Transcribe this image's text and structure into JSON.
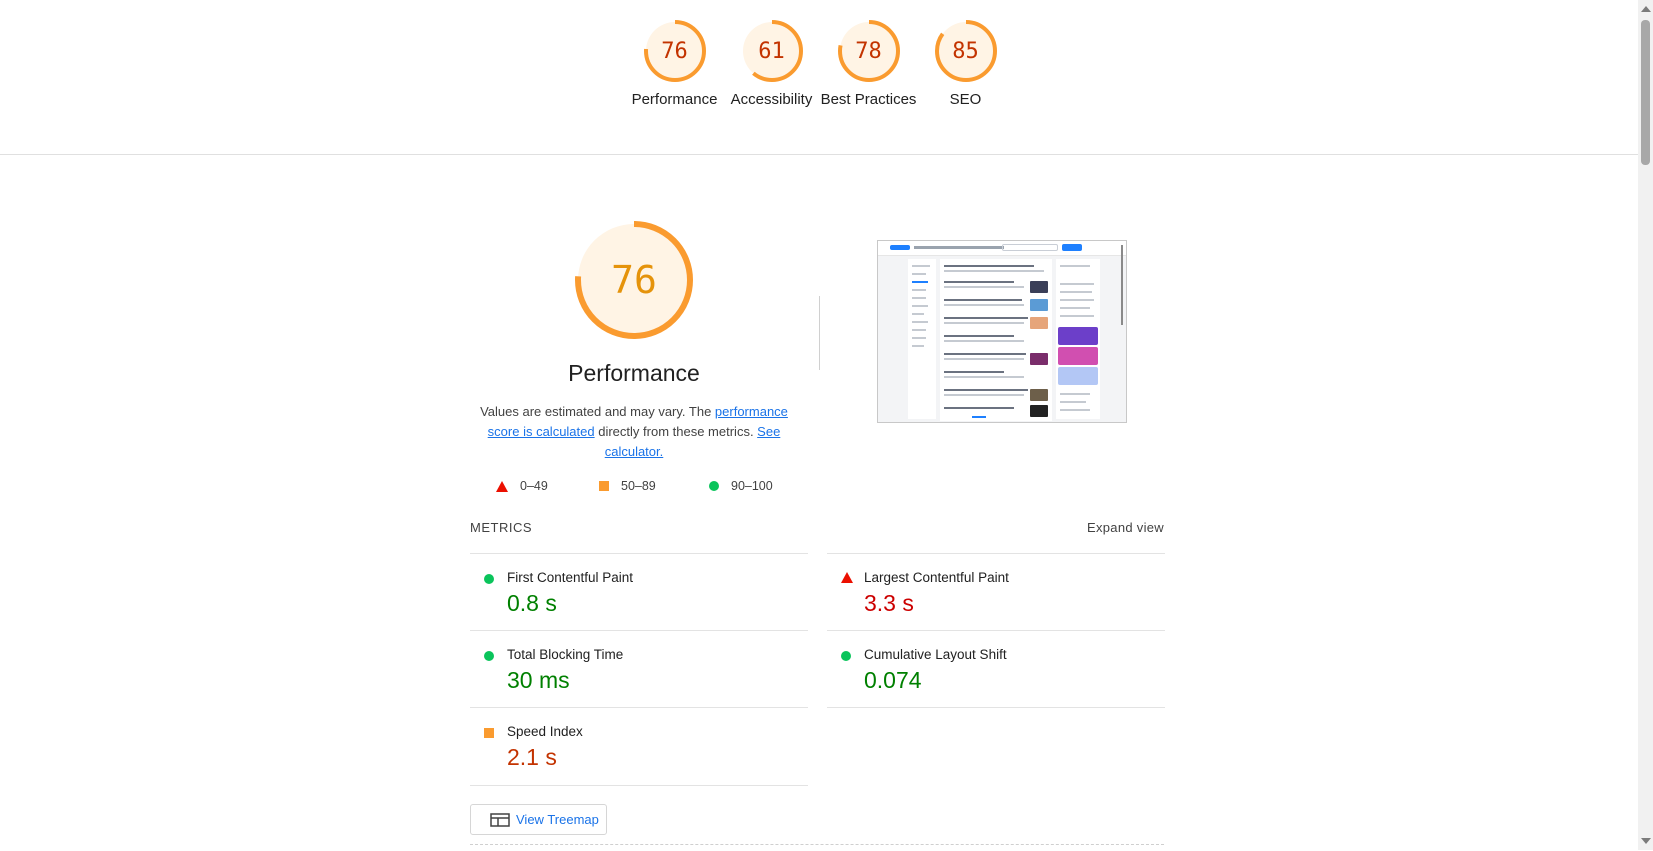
{
  "categories": [
    {
      "score": "76",
      "label": "Performance",
      "fraction": 0.76
    },
    {
      "score": "61",
      "label": "Accessibility",
      "fraction": 0.61
    },
    {
      "score": "78",
      "label": "Best Practices",
      "fraction": 0.78
    },
    {
      "score": "85",
      "label": "SEO",
      "fraction": 0.85
    }
  ],
  "performance": {
    "score": "76",
    "fraction": 0.76,
    "title": "Performance",
    "desc_prefix": "Values are estimated and may vary. The ",
    "desc_link1": "performance score is calculated",
    "desc_middle": " directly from these metrics. ",
    "desc_link2": "See calculator."
  },
  "legend": {
    "poor": "0–49",
    "average": "50–89",
    "good": "90–100"
  },
  "metrics": {
    "header": "METRICS",
    "expand": "Expand view",
    "items": [
      {
        "name": "First Contentful Paint",
        "value": "0.8 s",
        "rating": "good"
      },
      {
        "name": "Largest Contentful Paint",
        "value": "3.3 s",
        "rating": "poor"
      },
      {
        "name": "Total Blocking Time",
        "value": "30 ms",
        "rating": "good"
      },
      {
        "name": "Cumulative Layout Shift",
        "value": "0.074",
        "rating": "good"
      },
      {
        "name": "Speed Index",
        "value": "2.1 s",
        "rating": "average"
      }
    ]
  },
  "treemap": {
    "label": "View Treemap",
    "icon": "treemap-icon"
  },
  "colors": {
    "average": "#fa9b2f",
    "average_bg": "#fff4e5",
    "poor": "#eb0f00",
    "good": "#0ac45b",
    "link": "#1a73e8"
  }
}
